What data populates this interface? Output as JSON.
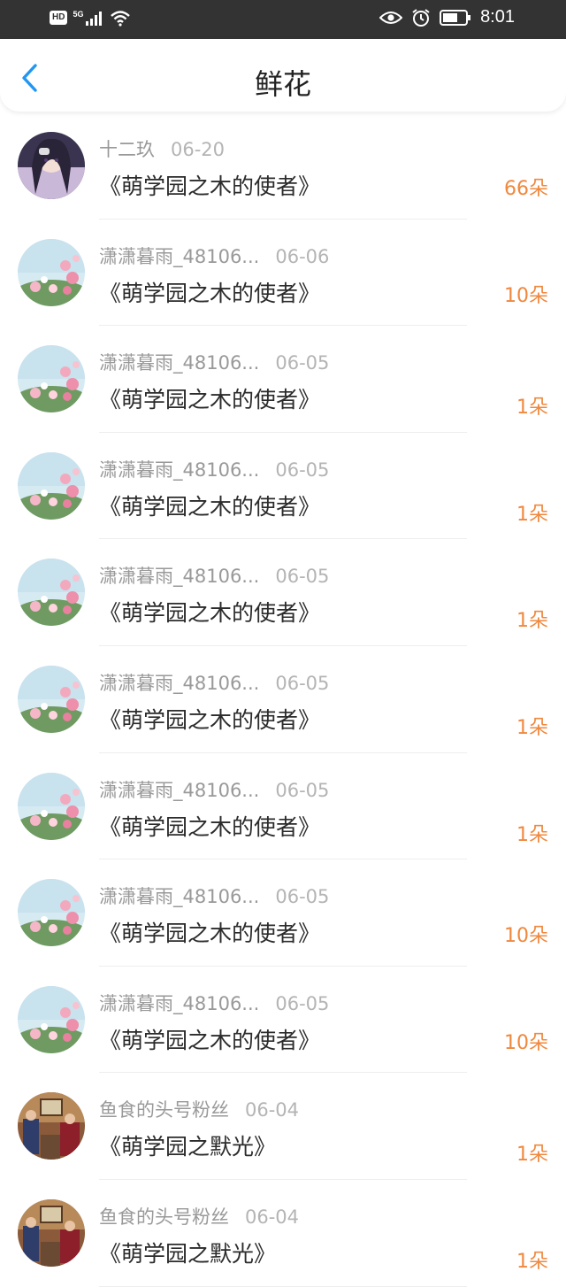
{
  "status_bar": {
    "badge": "HD",
    "network": "5G",
    "time": "8:01",
    "icons": [
      "signal-icon",
      "wifi-icon",
      "eye-icon",
      "alarm-icon",
      "battery-icon"
    ]
  },
  "nav": {
    "title": "鲜花",
    "back_icon": "chevron-left-icon",
    "accent_color": "#2196f3"
  },
  "colors": {
    "count": "#f0883e",
    "name": "#999999",
    "title": "#2b2b2b"
  },
  "rows": [
    {
      "name": "十二玖",
      "date": "06-20",
      "title": "《萌学园之木的使者》",
      "count": "66朵",
      "avatar": "anime-girl-avatar"
    },
    {
      "name": "潇潇暮雨_48106...",
      "date": "06-06",
      "title": "《萌学园之木的使者》",
      "count": "10朵",
      "avatar": "flower-avatar"
    },
    {
      "name": "潇潇暮雨_48106...",
      "date": "06-05",
      "title": "《萌学园之木的使者》",
      "count": "1朵",
      "avatar": "flower-avatar"
    },
    {
      "name": "潇潇暮雨_48106...",
      "date": "06-05",
      "title": "《萌学园之木的使者》",
      "count": "1朵",
      "avatar": "flower-avatar"
    },
    {
      "name": "潇潇暮雨_48106...",
      "date": "06-05",
      "title": "《萌学园之木的使者》",
      "count": "1朵",
      "avatar": "flower-avatar"
    },
    {
      "name": "潇潇暮雨_48106...",
      "date": "06-05",
      "title": "《萌学园之木的使者》",
      "count": "1朵",
      "avatar": "flower-avatar"
    },
    {
      "name": "潇潇暮雨_48106...",
      "date": "06-05",
      "title": "《萌学园之木的使者》",
      "count": "1朵",
      "avatar": "flower-avatar"
    },
    {
      "name": "潇潇暮雨_48106...",
      "date": "06-05",
      "title": "《萌学园之木的使者》",
      "count": "10朵",
      "avatar": "flower-avatar"
    },
    {
      "name": "潇潇暮雨_48106...",
      "date": "06-05",
      "title": "《萌学园之木的使者》",
      "count": "10朵",
      "avatar": "flower-avatar"
    },
    {
      "name": "鱼食的头号粉丝",
      "date": "06-04",
      "title": "《萌学园之默光》",
      "count": "1朵",
      "avatar": "painting-avatar"
    },
    {
      "name": "鱼食的头号粉丝",
      "date": "06-04",
      "title": "《萌学园之默光》",
      "count": "1朵",
      "avatar": "painting-avatar"
    }
  ]
}
